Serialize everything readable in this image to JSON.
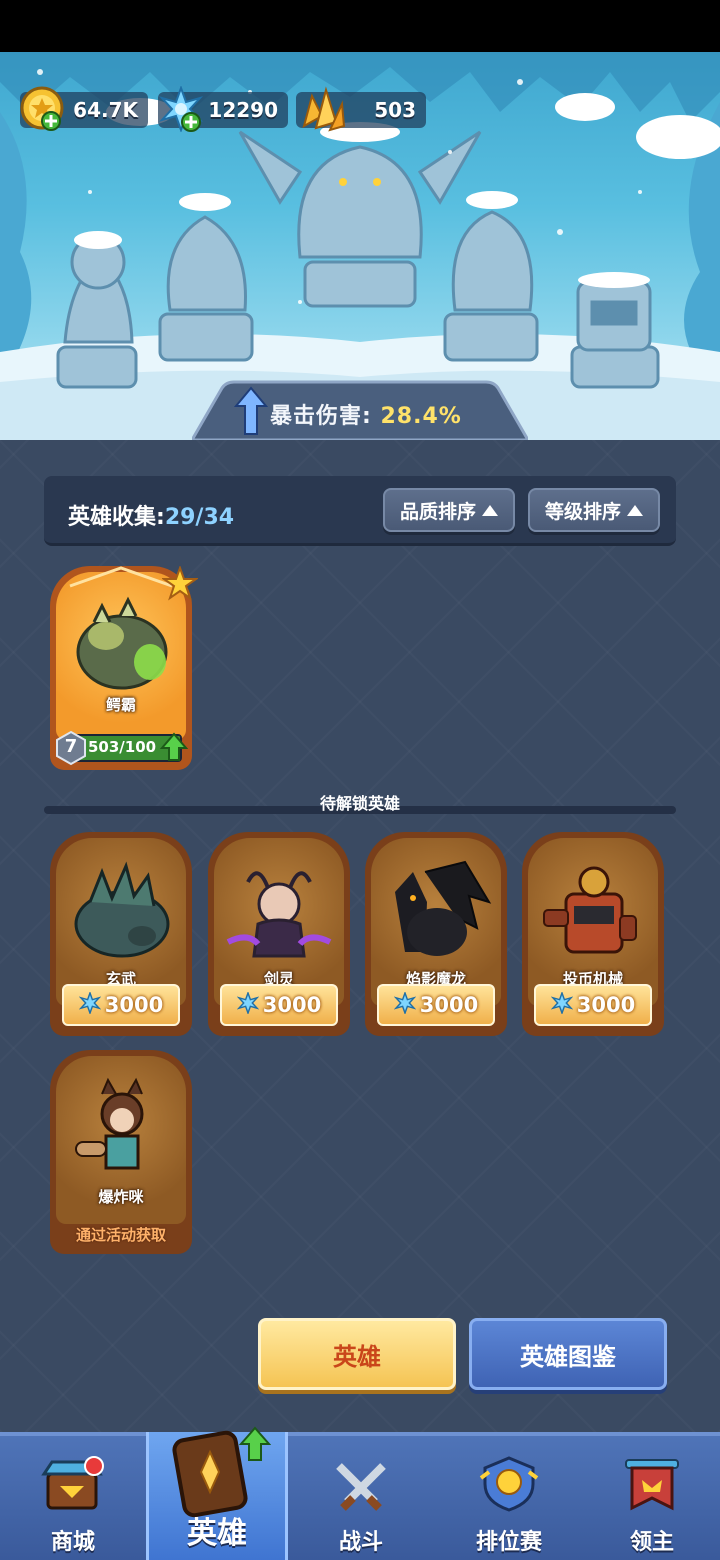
{
  "resources": {
    "gold": "64.7K",
    "gems": "12290",
    "crystals": "503"
  },
  "crit_banner": {
    "label": "暴击伤害:",
    "value": "28.4%"
  },
  "collection": {
    "label": "英雄收集:",
    "count": "29/34",
    "sort_quality": "品质排序",
    "sort_level": "等级排序"
  },
  "owned_heroes": [
    {
      "name": "鳄霸",
      "level": "7",
      "progress": "503/100",
      "progress_fraction": 1.0
    }
  ],
  "locked_section_title": "待解锁英雄",
  "locked_heroes": [
    {
      "name": "玄武",
      "price": "3000"
    },
    {
      "name": "剑灵",
      "price": "3000"
    },
    {
      "name": "焰影魔龙",
      "price": "3000"
    },
    {
      "name": "投币机械",
      "price": "3000"
    },
    {
      "name": "爆炸咪",
      "note": "通过活动获取"
    }
  ],
  "buttons": {
    "hero": "英雄",
    "hero_guide": "英雄图鉴"
  },
  "nav": {
    "tabs": [
      {
        "label": "商城",
        "icon": "shop-chest-icon"
      },
      {
        "label": "英雄",
        "icon": "hero-card-icon",
        "active": true
      },
      {
        "label": "战斗",
        "icon": "crossed-swords-icon"
      },
      {
        "label": "排位赛",
        "icon": "rank-shield-icon"
      },
      {
        "label": "领主",
        "icon": "lord-banner-icon"
      }
    ]
  },
  "colors": {
    "panel_bg": "#3a4a62",
    "accent_gold": "#ffe26a",
    "nav_blue": "#3a5a9b"
  }
}
